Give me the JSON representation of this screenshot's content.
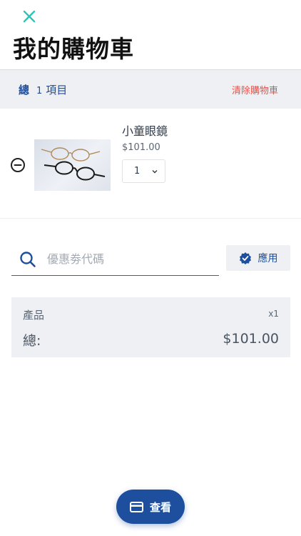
{
  "header": {
    "close_icon": "close-icon",
    "title": "我的購物車"
  },
  "summary": {
    "total_label": "總",
    "item_count": "1",
    "items_label": "項目",
    "clear_label": "清除購物車"
  },
  "cart": {
    "items": [
      {
        "name": "小童眼鏡",
        "price": "$101.00",
        "quantity": "1",
        "image_icon": "eyeglasses-image"
      }
    ]
  },
  "coupon": {
    "placeholder": "優惠劵代碼",
    "value": "",
    "apply_label": "應用"
  },
  "totals": {
    "products_label": "產品",
    "products_count": "x1",
    "total_label": "總:",
    "total_value": "$101.00"
  },
  "checkout": {
    "label": "查看"
  },
  "colors": {
    "accent_teal": "#2ec4b6",
    "brand_blue": "#1d4f9e",
    "danger_red": "#e5524b",
    "panel_gray": "#eef0f3"
  }
}
